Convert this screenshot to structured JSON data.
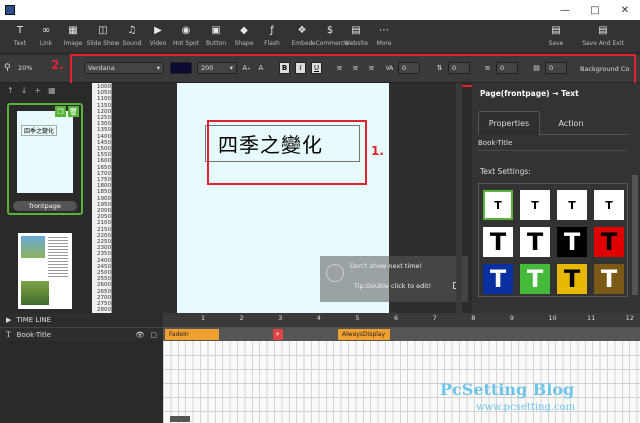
{
  "toolbar": {
    "items": [
      {
        "icon": "text-icon",
        "label": "Text"
      },
      {
        "icon": "link-icon",
        "label": "Link"
      },
      {
        "icon": "image-icon",
        "label": "Image"
      },
      {
        "icon": "slideshow-icon",
        "label": "Slide Show"
      },
      {
        "icon": "sound-icon",
        "label": "Sound"
      },
      {
        "icon": "video-icon",
        "label": "Video"
      },
      {
        "icon": "hotspot-icon",
        "label": "Hot Spot"
      },
      {
        "icon": "button-icon",
        "label": "Button"
      },
      {
        "icon": "shape-icon",
        "label": "Shape"
      },
      {
        "icon": "flash-icon",
        "label": "Flash"
      },
      {
        "icon": "embed-icon",
        "label": "Embed"
      },
      {
        "icon": "ecommerce-icon",
        "label": "eCommerce"
      },
      {
        "icon": "website-icon",
        "label": "Website"
      },
      {
        "icon": "more-icon",
        "label": "More"
      }
    ],
    "save_label": "Save",
    "save_exit_label": "Save And Exit"
  },
  "format": {
    "zoom": "20%",
    "font": "Verdana",
    "size": "200",
    "color": "#0a0a33",
    "spacing1": "0",
    "spacing2": "0",
    "spacing3": "0",
    "spacing4": "0",
    "background_label": "Background Co"
  },
  "annotations": {
    "label1": "1.",
    "label2": "2."
  },
  "pages": {
    "frontpage_label": "frontpage",
    "thumb1_text": "四季之變化"
  },
  "ruler_marks": [
    "1000",
    "1050",
    "1100",
    "1150",
    "1200",
    "1250",
    "1300",
    "1350",
    "1400",
    "1450",
    "1500",
    "1550",
    "1600",
    "1650",
    "1700",
    "1750",
    "1800",
    "1850",
    "1900",
    "1950",
    "2000",
    "2050",
    "2100",
    "2150",
    "2200",
    "2250",
    "2300",
    "2350",
    "2400",
    "2450",
    "2500",
    "2550",
    "2600",
    "2650",
    "2700",
    "2750",
    "2800"
  ],
  "canvas": {
    "text": "四季之變化",
    "tip_line1": "Don't show next time!",
    "tip_line2": "Tip:Double click to edit!"
  },
  "properties": {
    "breadcrumb": "Page(frontpage) → Text",
    "tab_properties": "Properties",
    "tab_action": "Action",
    "object_name": "Book-Title",
    "text_settings_label": "Text Settings:",
    "style_letter": "T",
    "swatches": [
      {
        "bg": "#ffffff",
        "fg": "#000000"
      },
      {
        "bg": "#ffffff",
        "fg": "#000000"
      },
      {
        "bg": "#ffffff",
        "fg": "#000000"
      },
      {
        "bg": "#ffffff",
        "fg": "#000000"
      },
      {
        "bg": "#ffffff",
        "fg": "#000000"
      },
      {
        "bg": "#ffffff",
        "fg": "#000000"
      },
      {
        "bg": "#000000",
        "fg": "#ffffff"
      },
      {
        "bg": "#e00000",
        "fg": "#000000"
      },
      {
        "bg": "#0a2fa0",
        "fg": "#ffffff"
      },
      {
        "bg": "#44b93a",
        "fg": "#ffffff"
      },
      {
        "bg": "#e6b800",
        "fg": "#000000"
      },
      {
        "bg": "#7a5a14",
        "fg": "#ffffff"
      }
    ]
  },
  "timeline": {
    "header": "TIME LINE",
    "layer": "Book-Title",
    "ticks": [
      "1",
      "2",
      "3",
      "4",
      "5",
      "6",
      "7",
      "8",
      "9",
      "10",
      "11",
      "12"
    ],
    "seg_fadein": "FadeIn",
    "seg_always": "AlwaysDisplay"
  },
  "watermark": {
    "title": "PcSetting Blog",
    "url": "www.pcsetting.com"
  }
}
